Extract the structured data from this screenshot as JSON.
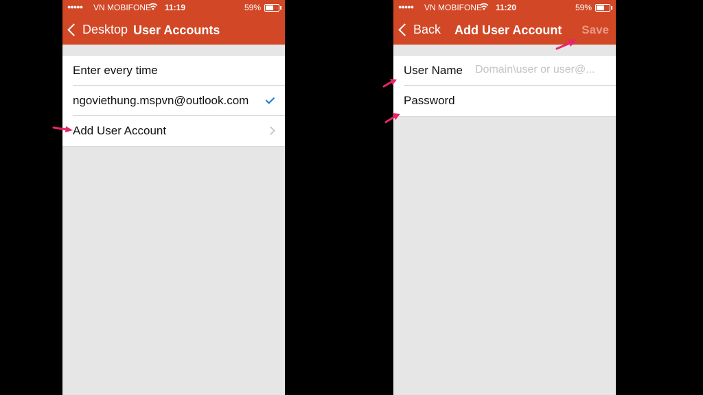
{
  "left": {
    "status": {
      "signal": "●●●●●",
      "carrier": "VN MOBIFONE",
      "time": "11:19",
      "battery": "59%"
    },
    "nav": {
      "back_label": "Desktop",
      "title": "User Accounts"
    },
    "rows": [
      {
        "label": "Enter every time"
      },
      {
        "label": "ngoviethung.mspvn@outlook.com"
      },
      {
        "label": "Add User Account"
      }
    ]
  },
  "right": {
    "status": {
      "signal": "●●●●●",
      "carrier": "VN MOBIFONE",
      "time": "11:20",
      "battery": "59%"
    },
    "nav": {
      "back_label": "Back",
      "title": "Add User Account",
      "save_label": "Save"
    },
    "fields": {
      "username": {
        "label": "User Name",
        "placeholder": "Domain\\user or user@..."
      },
      "password": {
        "label": "Password"
      }
    }
  },
  "colors": {
    "brand": "#d24726",
    "check": "#1a74d8",
    "annotation": "#e8256a"
  },
  "icons": [
    "wifi-icon",
    "battery-icon",
    "chevron-left-icon",
    "checkmark-icon",
    "disclosure-chevron-icon",
    "annotation-arrow-icon"
  ]
}
